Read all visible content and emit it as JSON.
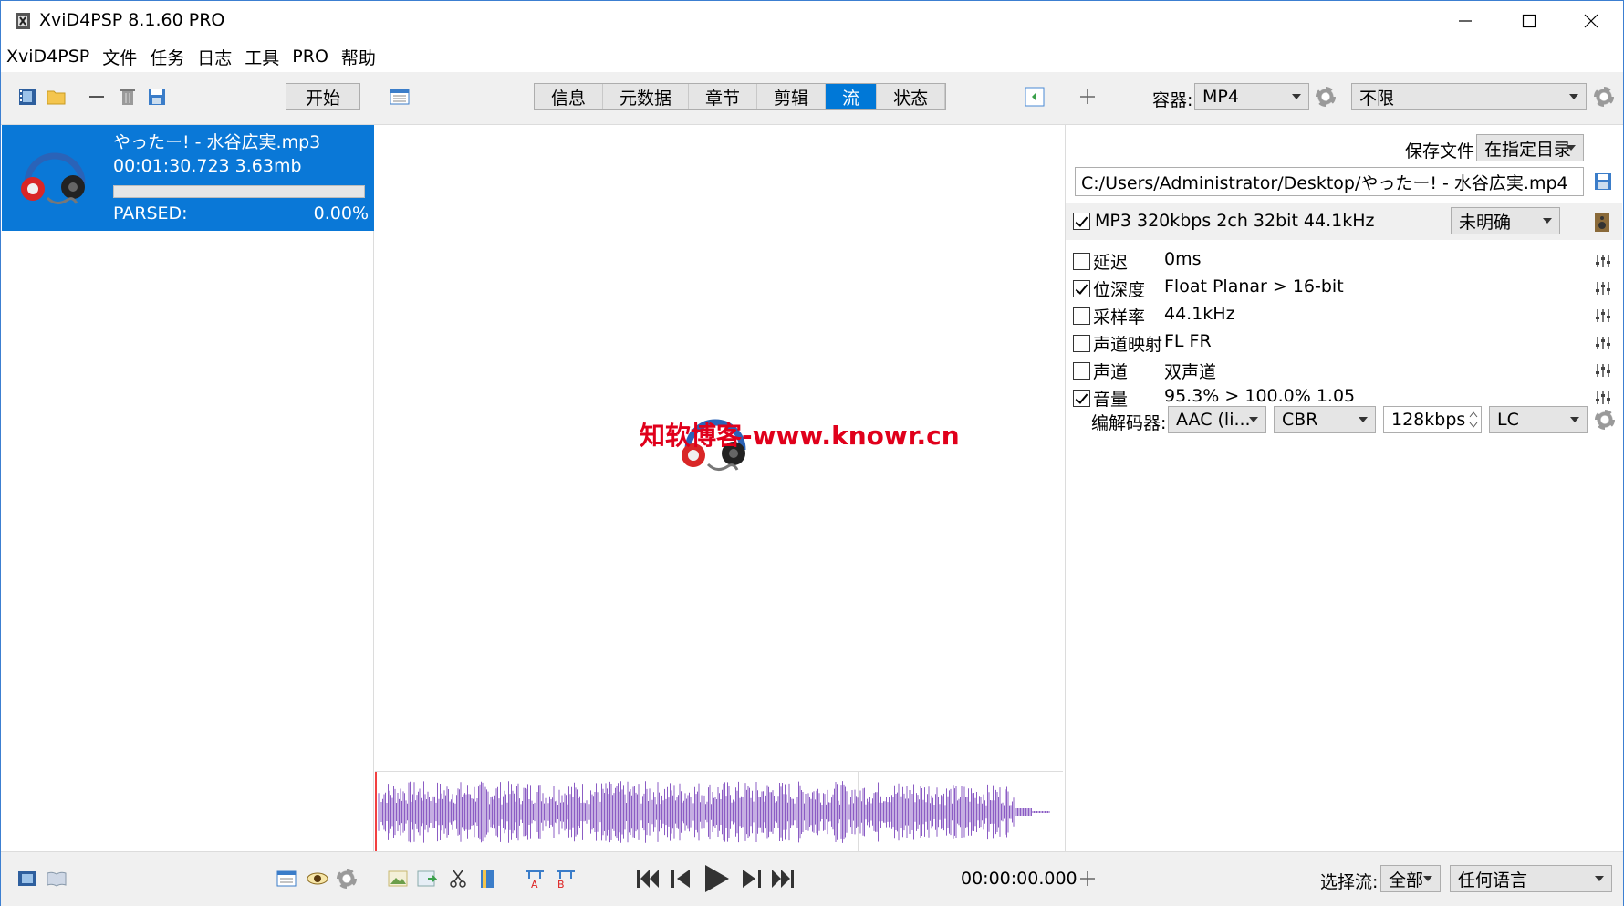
{
  "window": {
    "title": "XviD4PSP 8.1.60 PRO"
  },
  "menu": [
    "XviD4PSP",
    "文件",
    "任务",
    "日志",
    "工具",
    "PRO",
    "帮助"
  ],
  "toolbar": {
    "start_label": "开始",
    "tabs": [
      "信息",
      "元数据",
      "章节",
      "剪辑",
      "流",
      "状态"
    ],
    "active_tab": "流",
    "container_label": "容器:",
    "container_value": "MP4",
    "limit_value": "不限"
  },
  "file": {
    "name": "やったー! - 水谷広実.mp3",
    "info": "00:01:30.723 3.63mb",
    "status": "PARSED:",
    "percent": "0.00%",
    "progress": 0.0
  },
  "watermark": "知软博客-www.knowr.cn",
  "output": {
    "save_label": "保存文件:",
    "save_mode": "在指定目录",
    "path": "C:/Users/Administrator/Desktop/やったー! - 水谷広実.mp4"
  },
  "audio": {
    "track": "MP3 320kbps 2ch 32bit 44.1kHz",
    "lang": "未明确",
    "rows": [
      {
        "label": "延迟",
        "value": "0ms",
        "checked": false
      },
      {
        "label": "位深度",
        "value": "Float Planar > 16-bit",
        "checked": true
      },
      {
        "label": "采样率",
        "value": "44.1kHz",
        "checked": false
      },
      {
        "label": "声道映射",
        "value": "FL FR",
        "checked": false
      },
      {
        "label": "声道",
        "value": "双声道",
        "checked": false
      },
      {
        "label": "音量",
        "value": "95.3% > 100.0% 1.05",
        "checked": true
      }
    ],
    "codec_label": "编解码器:",
    "codec": "AAC (li...",
    "mode": "CBR",
    "bitrate": "128kbps",
    "profile": "LC"
  },
  "status": {
    "time": "00:00:00.000",
    "select_label": "选择流:",
    "select_value": "全部",
    "language_value": "任何语言"
  },
  "colors": {
    "accent": "#0078d7",
    "waveform": "#8b5cc4",
    "watermark": "#e0001b"
  }
}
